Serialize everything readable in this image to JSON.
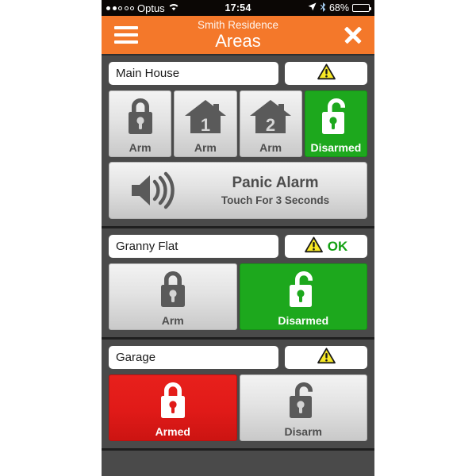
{
  "statusbar": {
    "carrier": "Optus",
    "time": "17:54",
    "battery_percent": "68%",
    "signal_dots_filled": 2,
    "signal_dots_total": 5,
    "wifi_icon": "wifi-icon",
    "location_icon": "location-arrow-icon",
    "bluetooth_icon": "bluetooth-icon",
    "battery_icon": "battery-icon"
  },
  "header": {
    "menu_icon": "hamburger-menu-icon",
    "subtitle": "Smith Residence",
    "title": "Areas",
    "close_icon": "close-icon",
    "accent_color": "#f4782a"
  },
  "colors": {
    "armed_red": "#e01a18",
    "disarmed_green": "#1da81d",
    "panel_grey": "#4a4a4a",
    "warning_yellow": "#f7e825"
  },
  "areas": [
    {
      "name": "Main House",
      "status_icon": "warning-triangle-icon",
      "status_text": "",
      "buttons": [
        {
          "label": "Arm",
          "icon": "padlock-closed-icon",
          "state": "grey"
        },
        {
          "label": "Arm",
          "icon": "house-1-icon",
          "state": "grey"
        },
        {
          "label": "Arm",
          "icon": "house-2-icon",
          "state": "grey"
        },
        {
          "label": "Disarmed",
          "icon": "padlock-open-icon",
          "state": "green"
        }
      ],
      "panic": {
        "icon": "speaker-icon",
        "title": "Panic Alarm",
        "subtitle": "Touch For 3 Seconds"
      }
    },
    {
      "name": "Granny Flat",
      "status_icon": "warning-triangle-icon",
      "status_text": "OK",
      "buttons": [
        {
          "label": "Arm",
          "icon": "padlock-closed-icon",
          "state": "grey"
        },
        {
          "label": "Disarmed",
          "icon": "padlock-open-icon",
          "state": "green"
        }
      ]
    },
    {
      "name": "Garage",
      "status_icon": "warning-triangle-icon",
      "status_text": "",
      "buttons": [
        {
          "label": "Armed",
          "icon": "padlock-closed-icon",
          "state": "red"
        },
        {
          "label": "Disarm",
          "icon": "padlock-open-icon",
          "state": "grey"
        }
      ]
    }
  ]
}
